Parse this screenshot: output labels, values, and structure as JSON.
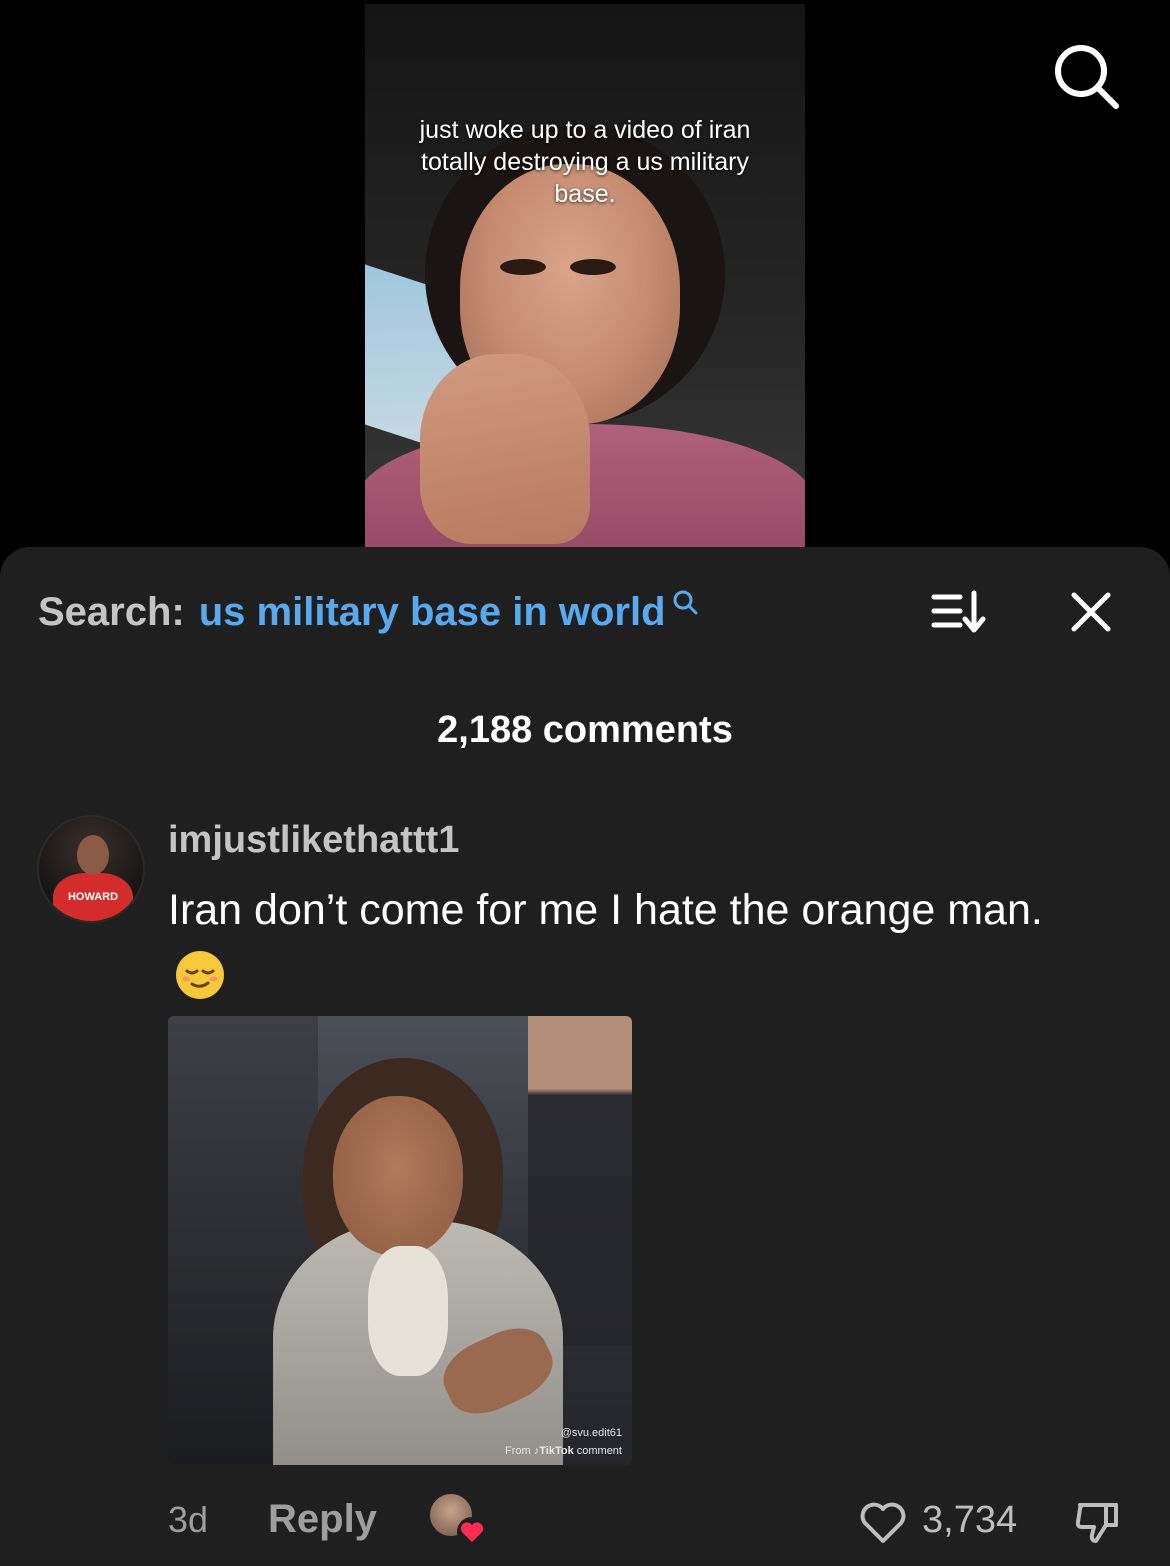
{
  "video": {
    "caption": "just woke up to a video of iran totally destroying a us military base."
  },
  "top_search_icon": "search-icon",
  "sheet": {
    "search_label": "Search:",
    "search_query": "us military base in world",
    "sort_icon": "sort-icon",
    "close_icon": "close-icon",
    "comment_count": "2,188 comments"
  },
  "comment": {
    "username": "imjustlikethattt1",
    "avatar_shirt_text": "HOWARD",
    "text": "Iran don’t come for me I hate the orange man.",
    "emoji": "relieved-face",
    "attachment": {
      "watermark_handle": "@svu.edit61",
      "watermark_from": "From",
      "watermark_brand": "TikTok",
      "watermark_suffix": "comment"
    },
    "time": "3d",
    "reply_label": "Reply",
    "like_count": "3,734"
  },
  "colors": {
    "query_blue": "#58a9ee",
    "sheet_bg": "#1f1f1f",
    "heart_red": "#fe2c55"
  }
}
